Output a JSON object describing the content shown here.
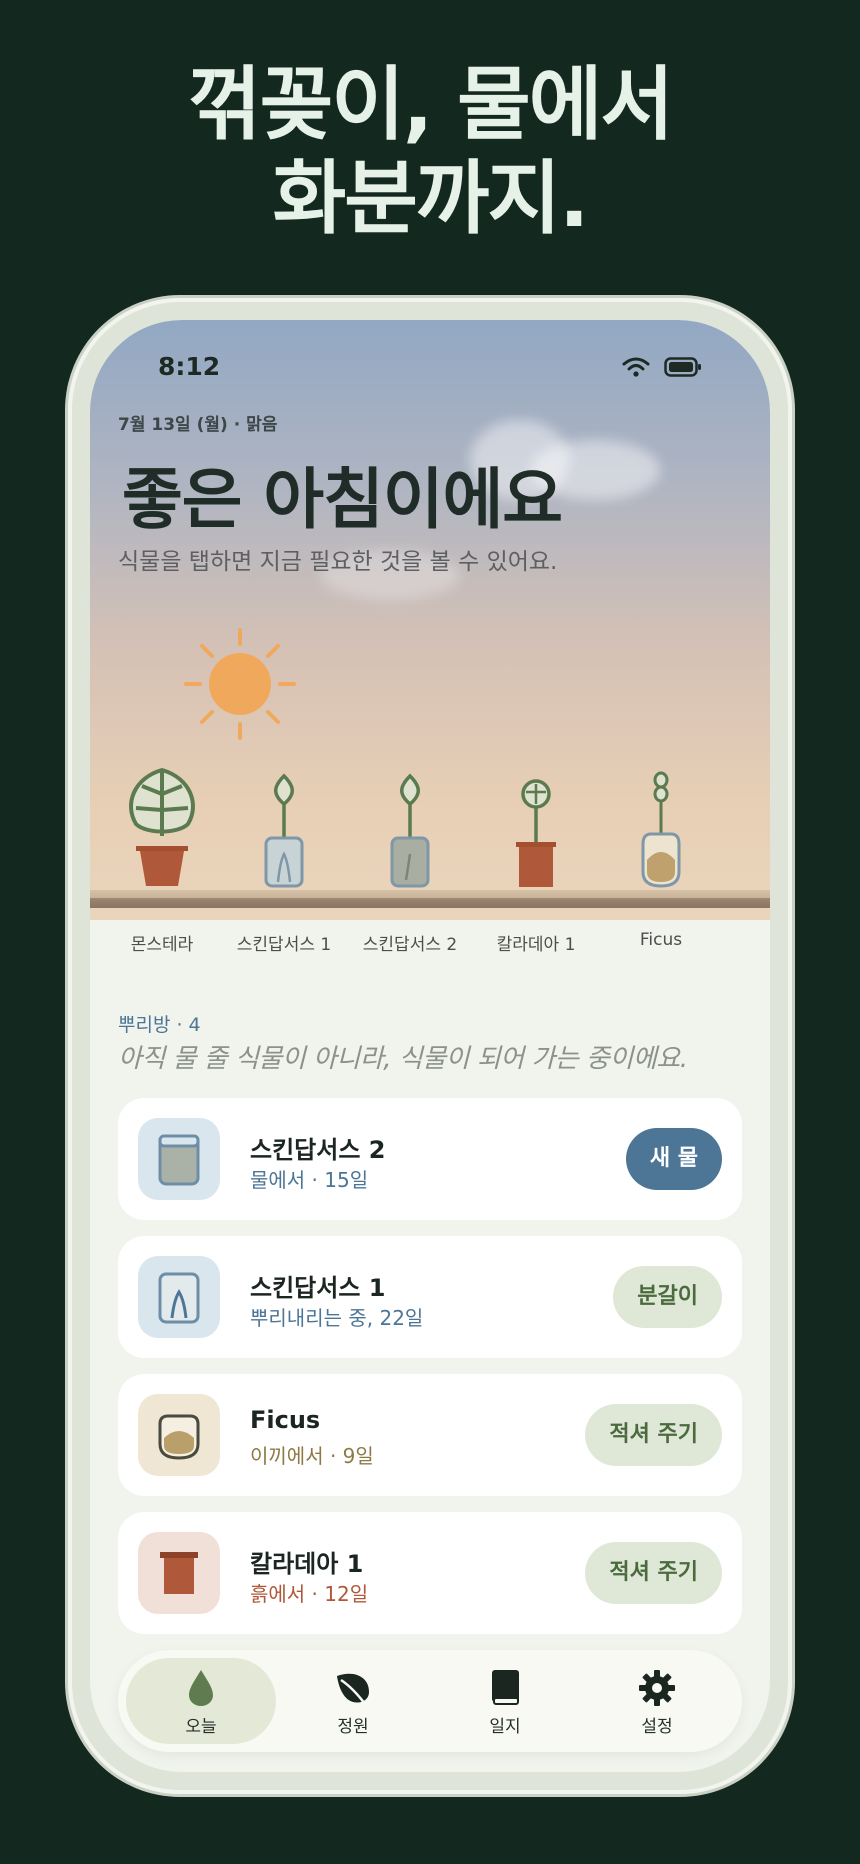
{
  "headline": {
    "line1": "꺾꽂이, 물에서",
    "line2": "화분까지."
  },
  "status": {
    "time": "8:12"
  },
  "header": {
    "date": "7월 13일 (월) · 맑음",
    "greeting": "좋은 아침이에요",
    "subtitle": "식물을 탭하면 지금 필요한 것을 볼 수 있어요."
  },
  "shelf": {
    "plants": [
      {
        "name": "몬스테라"
      },
      {
        "name": "스킨답서스 1"
      },
      {
        "name": "스킨답서스 2"
      },
      {
        "name": "칼라데아 1"
      },
      {
        "name": "Ficus"
      }
    ]
  },
  "section": {
    "title": "뿌리방 · 4",
    "description": "아직 물 줄 식물이 아니라, 식물이 되어 가는 중이에요."
  },
  "cards": [
    {
      "name": "스킨답서스 2",
      "status": "물에서 · 15일",
      "action": "새 물",
      "status_color": "#4d7696"
    },
    {
      "name": "스킨답서스 1",
      "status": "뿌리내리는 중, 22일",
      "action": "분갈이",
      "status_color": "#4d7696"
    },
    {
      "name": "Ficus",
      "status": "이끼에서 · 9일",
      "action": "적셔 주기",
      "status_color": "#8d7a45"
    },
    {
      "name": "칼라데아 1",
      "status": "흙에서 · 12일",
      "action": "적셔 주기",
      "status_color": "#b0583a"
    }
  ],
  "nav": {
    "items": [
      {
        "label": "오늘",
        "icon": "drop-icon"
      },
      {
        "label": "정원",
        "icon": "leaf-icon"
      },
      {
        "label": "일지",
        "icon": "book-icon"
      },
      {
        "label": "설정",
        "icon": "gear-icon"
      }
    ]
  },
  "colors": {
    "background": "#13281f",
    "accent_blue": "#4d7696",
    "accent_green": "#dfe8d7",
    "terracotta": "#b0583a"
  }
}
